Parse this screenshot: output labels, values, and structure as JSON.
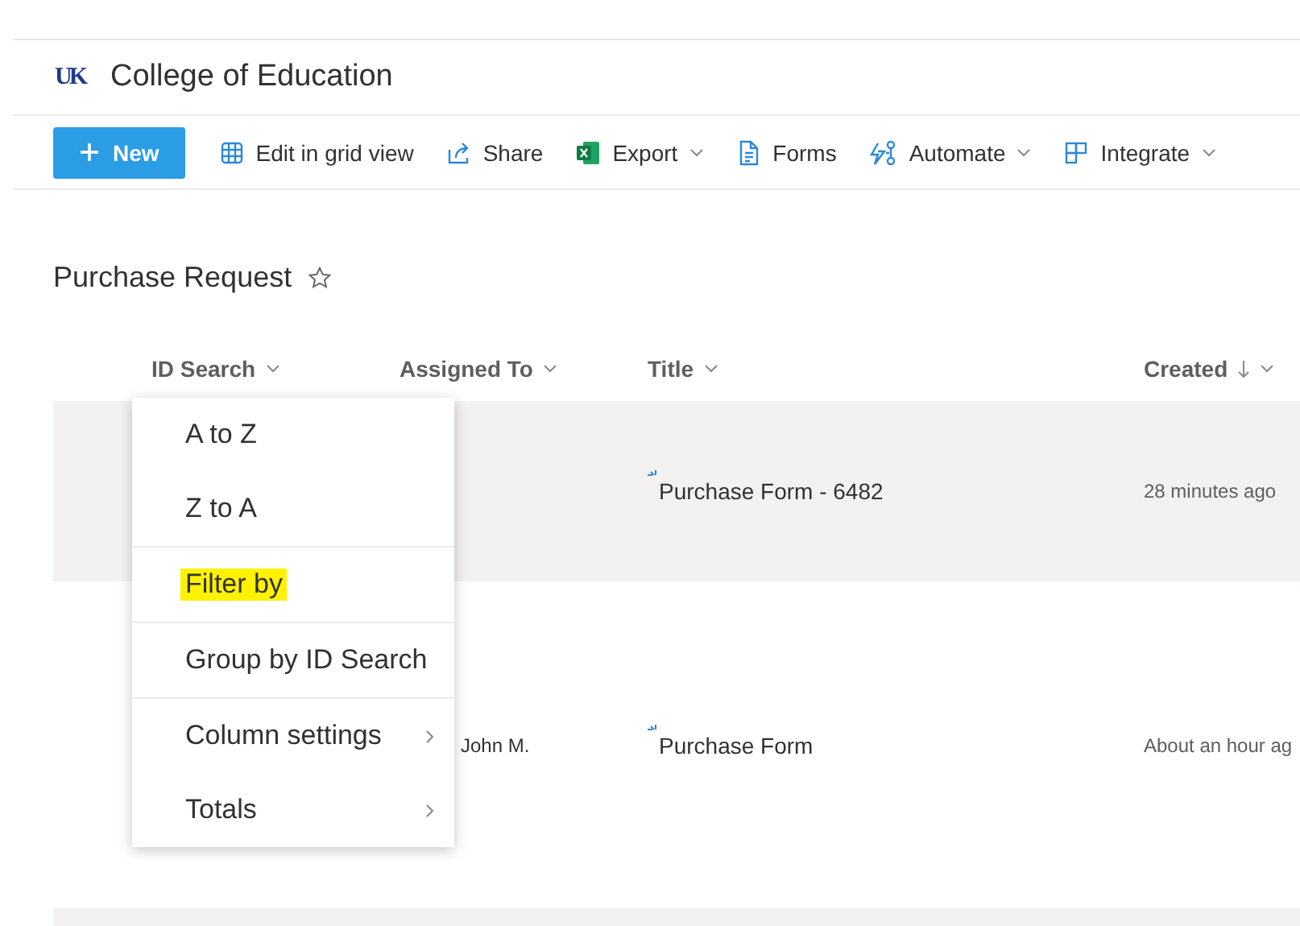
{
  "site": {
    "logo": "UK",
    "title": "College of Education"
  },
  "toolbar": [
    {
      "kind": "new",
      "label": "New",
      "dropdown": false
    },
    {
      "kind": "grid",
      "label": "Edit in grid view",
      "dropdown": false
    },
    {
      "kind": "share",
      "label": "Share",
      "dropdown": false
    },
    {
      "kind": "export",
      "label": "Export",
      "dropdown": true
    },
    {
      "kind": "forms",
      "label": "Forms",
      "dropdown": false
    },
    {
      "kind": "automate",
      "label": "Automate",
      "dropdown": true
    },
    {
      "kind": "integrate",
      "label": "Integrate",
      "dropdown": true
    }
  ],
  "list": {
    "title": "Purchase Request",
    "favorite": false
  },
  "table": {
    "columns": [
      {
        "label": "ID Search",
        "sorted_descending": false
      },
      {
        "label": "Assigned To",
        "sorted_descending": false
      },
      {
        "label": "Title",
        "sorted_descending": false
      },
      {
        "label": "Created",
        "sorted_descending": true
      }
    ],
    "rows": [
      {
        "selected": true,
        "assigned_to": "",
        "title": "Purchase Form - 6482",
        "created": "28 minutes ago"
      },
      {
        "selected": false,
        "assigned_to": "John M.",
        "title": "Purchase Form",
        "created": "About an hour ag"
      }
    ]
  },
  "column_menu": [
    {
      "label": "A to Z",
      "highlighted": false,
      "submenu": false,
      "divider_before": false
    },
    {
      "label": "Z to A",
      "highlighted": false,
      "submenu": false,
      "divider_before": false
    },
    {
      "label": "Filter by",
      "highlighted": true,
      "submenu": false,
      "divider_before": true
    },
    {
      "label": "Group by ID Search",
      "highlighted": false,
      "submenu": false,
      "divider_before": true
    },
    {
      "label": "Column settings",
      "highlighted": false,
      "submenu": true,
      "divider_before": true
    },
    {
      "label": "Totals",
      "highlighted": false,
      "submenu": true,
      "divider_before": false
    }
  ]
}
